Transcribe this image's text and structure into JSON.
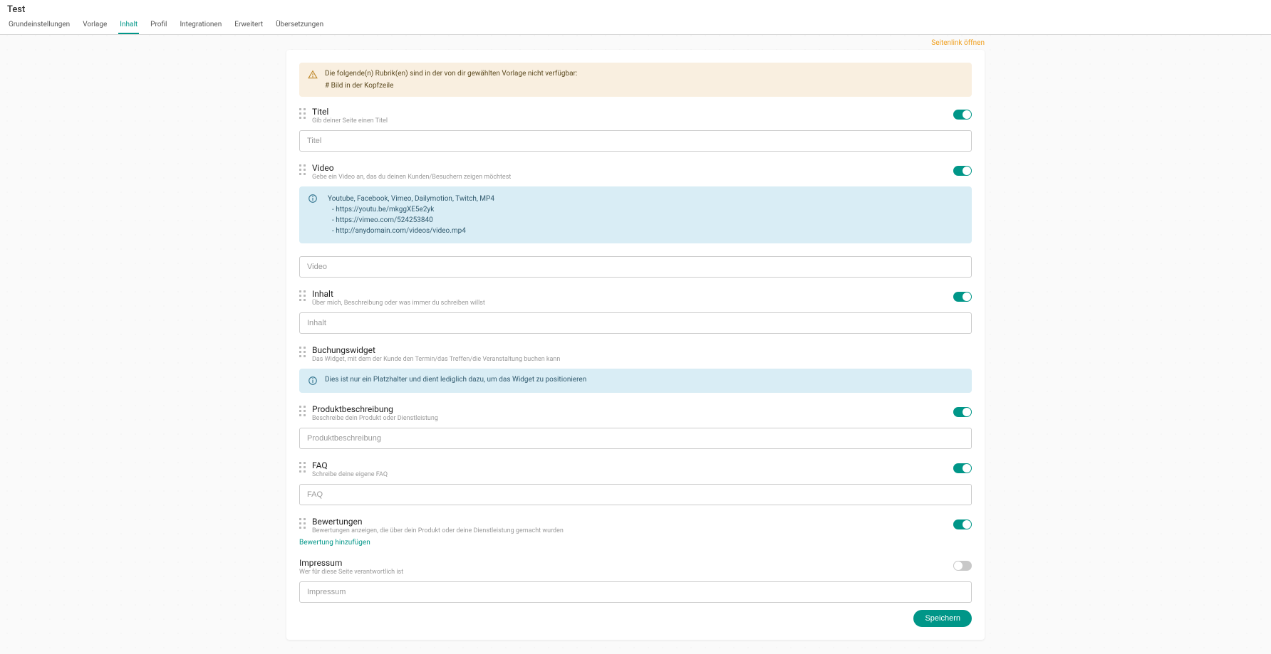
{
  "pageTitle": "Test",
  "tabs": [
    "Grundeinstellungen",
    "Vorlage",
    "Inhalt",
    "Profil",
    "Integrationen",
    "Erweitert",
    "Übersetzungen"
  ],
  "activeTab": 2,
  "openLink": "Seitenlink öffnen",
  "warnAlert": {
    "line1": "Die folgende(n) Rubrik(en) sind in der von dir gewählten Vorlage nicht verfügbar:",
    "line2": "# Bild in der Kopfzeile"
  },
  "sections": {
    "titel": {
      "title": "Titel",
      "desc": "Gib deiner Seite einen Titel",
      "placeholder": "Titel",
      "toggle": true
    },
    "video": {
      "title": "Video",
      "desc": "Gebe ein Video an, das du deinen Kunden/Besuchern zeigen möchtest",
      "placeholder": "Video",
      "toggle": true,
      "infoHead": "Youtube, Facebook, Vimeo, Dailymotion, Twitch, MP4",
      "ex1": "- https://youtu.be/mkggXE5e2yk",
      "ex2": "- https://vimeo.com/524253840",
      "ex3": "- http://anydomain.com/videos/video.mp4"
    },
    "inhalt": {
      "title": "Inhalt",
      "desc": "Über mich, Beschreibung oder was immer du schreiben willst",
      "placeholder": "Inhalt",
      "toggle": true
    },
    "buchung": {
      "title": "Buchungswidget",
      "desc": "Das Widget, mit dem der Kunde den Termin/das Treffen/die Veranstaltung buchen kann",
      "info": "Dies ist nur ein Platzhalter und dient lediglich dazu, um das Widget zu positionieren"
    },
    "produkt": {
      "title": "Produktbeschreibung",
      "desc": "Beschreibe dein Produkt oder Dienstleistung",
      "placeholder": "Produktbeschreibung",
      "toggle": true
    },
    "faq": {
      "title": "FAQ",
      "desc": "Schreibe deine eigene FAQ",
      "placeholder": "FAQ",
      "toggle": true
    },
    "bewert": {
      "title": "Bewertungen",
      "desc": "Bewertungen anzeigen, die über dein Produkt oder deine Dienstleistung gemacht wurden",
      "addLink": "Bewertung hinzufügen",
      "toggle": true
    },
    "impressum": {
      "title": "Impressum",
      "desc": "Wer für diese Seite verantwortlich ist",
      "placeholder": "Impressum",
      "toggle": false
    }
  },
  "saveLabel": "Speichern"
}
